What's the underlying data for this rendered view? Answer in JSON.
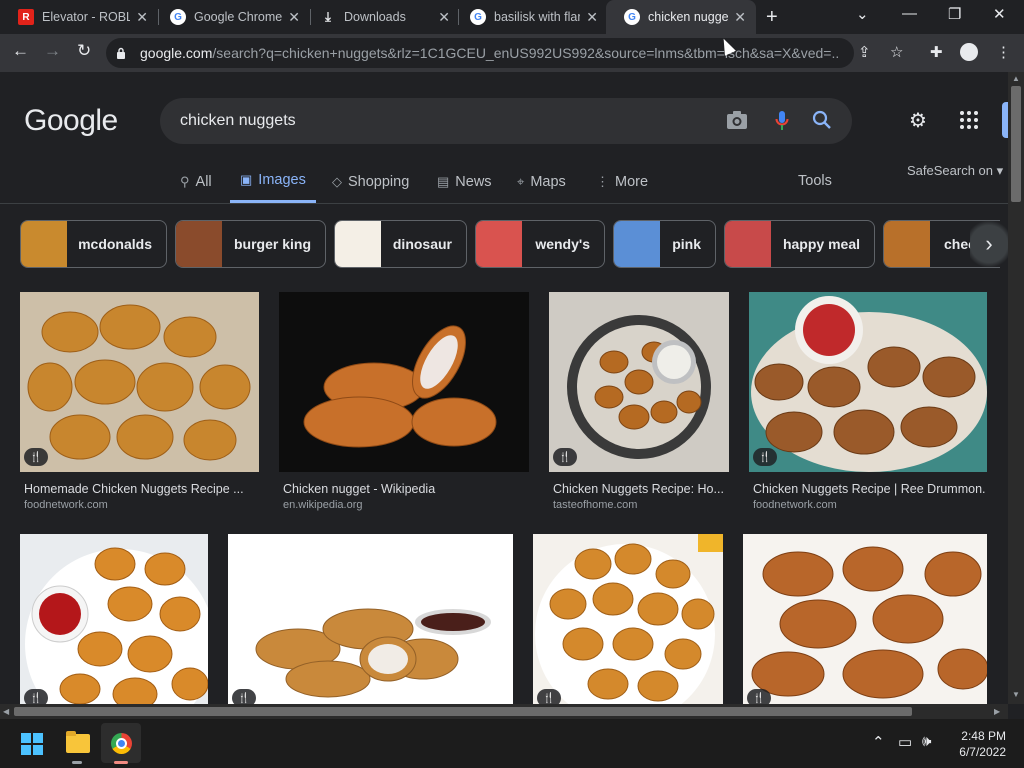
{
  "browser": {
    "tabs": [
      {
        "title": "Elevator - ROBLOX",
        "favicon": "roblox-icon",
        "active": false
      },
      {
        "title": "Google Chrome",
        "favicon": "google-icon",
        "active": false
      },
      {
        "title": "Downloads",
        "favicon": "download-icon",
        "active": false
      },
      {
        "title": "basilisk with flames",
        "favicon": "google-icon",
        "active": false
      },
      {
        "title": "chicken nuggets",
        "favicon": "google-icon",
        "active": true
      }
    ],
    "url_host": "google.com",
    "url_rest": "/search?q=chicken+nuggets&rlz=1C1GCEU_enUS992US992&source=lnms&tbm=isch&sa=X&ved=..."
  },
  "google": {
    "logo": "Google",
    "query": "chicken nuggets",
    "nav": [
      {
        "label": "All",
        "icon": "search-icon"
      },
      {
        "label": "Images",
        "icon": "image-icon",
        "active": true
      },
      {
        "label": "Shopping",
        "icon": "tag-icon"
      },
      {
        "label": "News",
        "icon": "news-icon"
      },
      {
        "label": "Maps",
        "icon": "map-pin-icon"
      },
      {
        "label": "More",
        "icon": "more-vert-icon"
      }
    ],
    "tools": "Tools",
    "safesearch": "SafeSearch on"
  },
  "chips": [
    {
      "label": "mcdonalds",
      "color": "#c98a2e"
    },
    {
      "label": "burger king",
      "color": "#8a4b2c"
    },
    {
      "label": "dinosaur",
      "color": "#e0a35a"
    },
    {
      "label": "wendy's",
      "color": "#d9534f"
    },
    {
      "label": "pink",
      "color": "#5b8fd6"
    },
    {
      "label": "happy meal",
      "color": "#c84a4a"
    },
    {
      "label": "chee",
      "color": "#b8702a"
    }
  ],
  "results": [
    {
      "title": "Homemade Chicken Nuggets Recipe ...",
      "source": "foodnetwork.com",
      "bg": "#cdbfa8",
      "food": "#c8862e"
    },
    {
      "title": "Chicken nugget - Wikipedia",
      "source": "en.wikipedia.org",
      "bg": "#0d0d0d",
      "food": "#c8702a"
    },
    {
      "title": "Chicken Nuggets Recipe: Ho...",
      "source": "tasteofhome.com",
      "bg": "#cfcbc4",
      "food": "#b56a22"
    },
    {
      "title": "Chicken Nuggets Recipe | Ree Drummon...",
      "source": "foodnetwork.com",
      "bg": "#3f8a86",
      "food": "#9a5a2a"
    },
    {
      "title": "",
      "source": "",
      "bg": "#e9ecef",
      "food": "#d98a2a"
    },
    {
      "title": "",
      "source": "",
      "bg": "#ffffff",
      "food": "#c9893b"
    },
    {
      "title": "",
      "source": "",
      "bg": "#f4f1ec",
      "food": "#d4892c"
    },
    {
      "title": "",
      "source": "",
      "bg": "#f6f3ef",
      "food": "#b8662a"
    }
  ],
  "taskbar": {
    "time": "2:48 PM",
    "date": "6/7/2022"
  }
}
